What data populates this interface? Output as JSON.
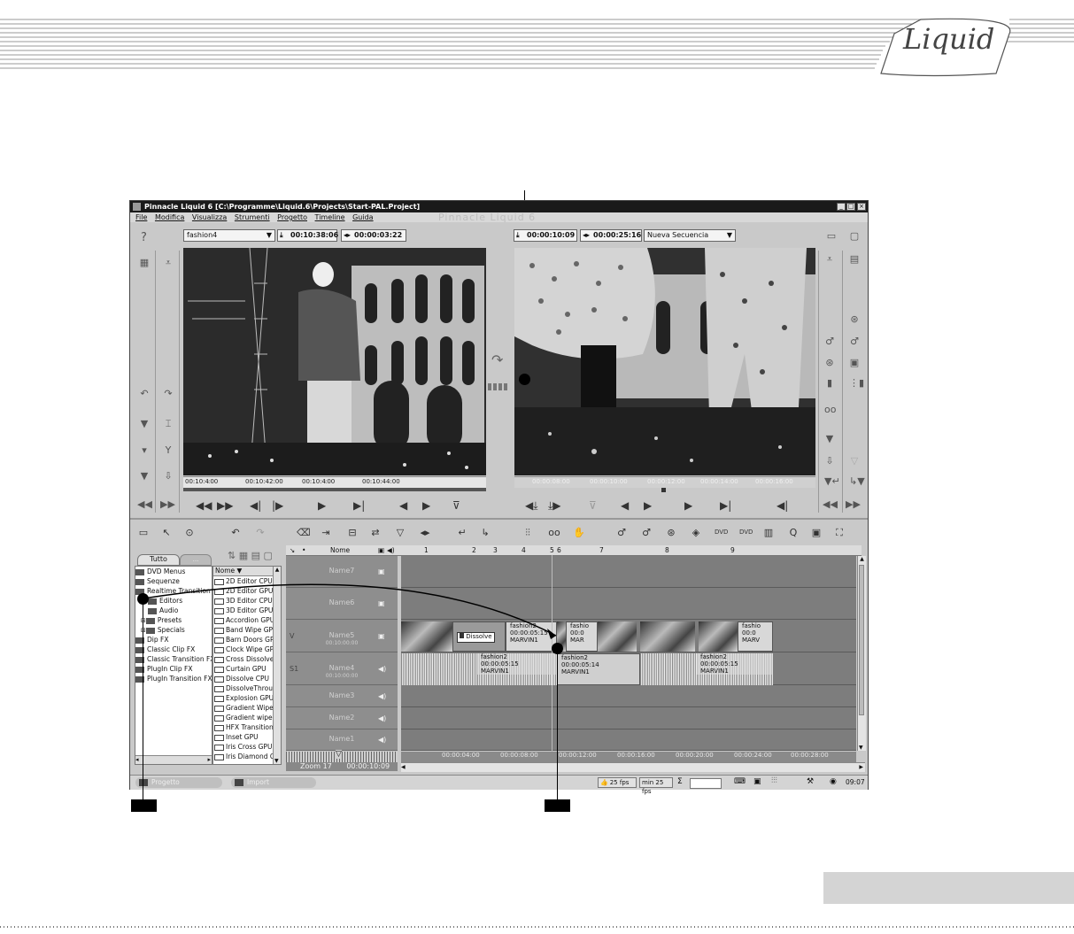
{
  "brand": {
    "logo_text": "Liquid"
  },
  "window": {
    "title": "Pinnacle Liquid 6 [C:\\Programme\\Liquid.6\\Projects\\Start-PAL.Project]",
    "watermark": "Pinnacle Liquid 6",
    "controls": [
      "_",
      "□",
      "×"
    ]
  },
  "menu": [
    "File",
    "Modifica",
    "Visualizza",
    "Strumenti",
    "Progetto",
    "Timeline",
    "Guida"
  ],
  "source_viewer": {
    "clip_name": "fashion4",
    "timecode_in": "00:10:38:06",
    "duration": "00:00:03:22",
    "ruler_labels": [
      "00:10:4",
      ":00",
      "00:10:42:00",
      "00:10:4",
      ":00",
      "00:10:44:00"
    ]
  },
  "record_viewer": {
    "timecode_in": "00:00:10:09",
    "duration": "00:00:25:16",
    "sequence_name": "Nueva Secuencia",
    "ruler_labels": [
      "00:00:08:00",
      "00:00:10:00",
      "00:00:12:00",
      "00:00:14:00",
      "00:00:16:00"
    ]
  },
  "browser": {
    "tabs": [
      "Tutto",
      "..."
    ],
    "tree": [
      {
        "label": "DVD Menus",
        "type": "folder"
      },
      {
        "label": "Sequenze",
        "type": "folder"
      },
      {
        "label": "Realtime Transition FX",
        "type": "folder"
      },
      {
        "label": "Editors",
        "type": "sub"
      },
      {
        "label": "Audio",
        "type": "sub"
      },
      {
        "label": "Presets",
        "type": "sub"
      },
      {
        "label": "Specials",
        "type": "sub"
      },
      {
        "label": "Dip FX",
        "type": "folder"
      },
      {
        "label": "Classic Clip FX",
        "type": "folder"
      },
      {
        "label": "Classic Transition FX",
        "type": "folder"
      },
      {
        "label": "PlugIn Clip FX",
        "type": "folder"
      },
      {
        "label": "PlugIn Transition FX",
        "type": "folder"
      }
    ],
    "list_header": "Nome ▼",
    "list": [
      "2D Editor CPU",
      "2D Editor GPU",
      "3D Editor CPU",
      "3D Editor GPU",
      "Accordion GPU",
      "Band Wipe GPU",
      "Barn Doors GPU",
      "Clock Wipe GPU",
      "Cross Dissolve C",
      "Curtain GPU",
      "Dissolve CPU",
      "DissolveThrougl",
      "Explosion GPU",
      "Gradient Wipe C",
      "Gradient wipe w",
      "HFX Transition",
      "Inset GPU",
      "Iris Cross GPU",
      "Iris Diamond GP"
    ]
  },
  "timeline": {
    "header_name": "Nome",
    "markers": [
      "1",
      "2",
      "3",
      "4",
      "5",
      "6",
      "7",
      "8",
      "9"
    ],
    "tracks": [
      {
        "id": "",
        "name": "Name7"
      },
      {
        "id": "",
        "name": "Name6"
      },
      {
        "id": "V",
        "name": "Name5",
        "tc": "00:10:00:00"
      },
      {
        "id": "S1",
        "name": "Name4",
        "tc": "00:10:00:00"
      },
      {
        "id": "",
        "name": "Name3"
      },
      {
        "id": "",
        "name": "Name2"
      },
      {
        "id": "",
        "name": "Name1"
      }
    ],
    "dissolve_label": "Dissolve",
    "clips": [
      {
        "name": "fashion2",
        "dur": "00:00:05:15",
        "src": "MARVIN1"
      },
      {
        "name": "fashio",
        "dur": "00:0",
        "src": "MAR"
      },
      {
        "name": "fashio",
        "dur": "00:0",
        "src": "MARV"
      }
    ],
    "audio_clips": [
      {
        "name": "fashion2",
        "dur": "00:00:05:15",
        "src": "MARVIN1"
      },
      {
        "name": "fashion2",
        "dur": "00:00:05:14",
        "src": "MARVIN1"
      },
      {
        "name": "fashion2",
        "dur": "00:00:05:15",
        "src": "MARVIN1"
      }
    ],
    "ruler": [
      "00:00:04:00",
      "00:00:08:00",
      "00:00:12:00",
      "00:00:16:00",
      "00:00:20:00",
      "00:00:24:00",
      "00:00:28:00"
    ],
    "zoom_label": "Zoom 17",
    "zoom_tc": "00:00:10:09"
  },
  "taskbar": {
    "items": [
      "Progetto",
      "Import"
    ],
    "fps": "25 fps",
    "min_fps": "min 25 fps",
    "sigma": "Σ",
    "clock": "09:07"
  }
}
